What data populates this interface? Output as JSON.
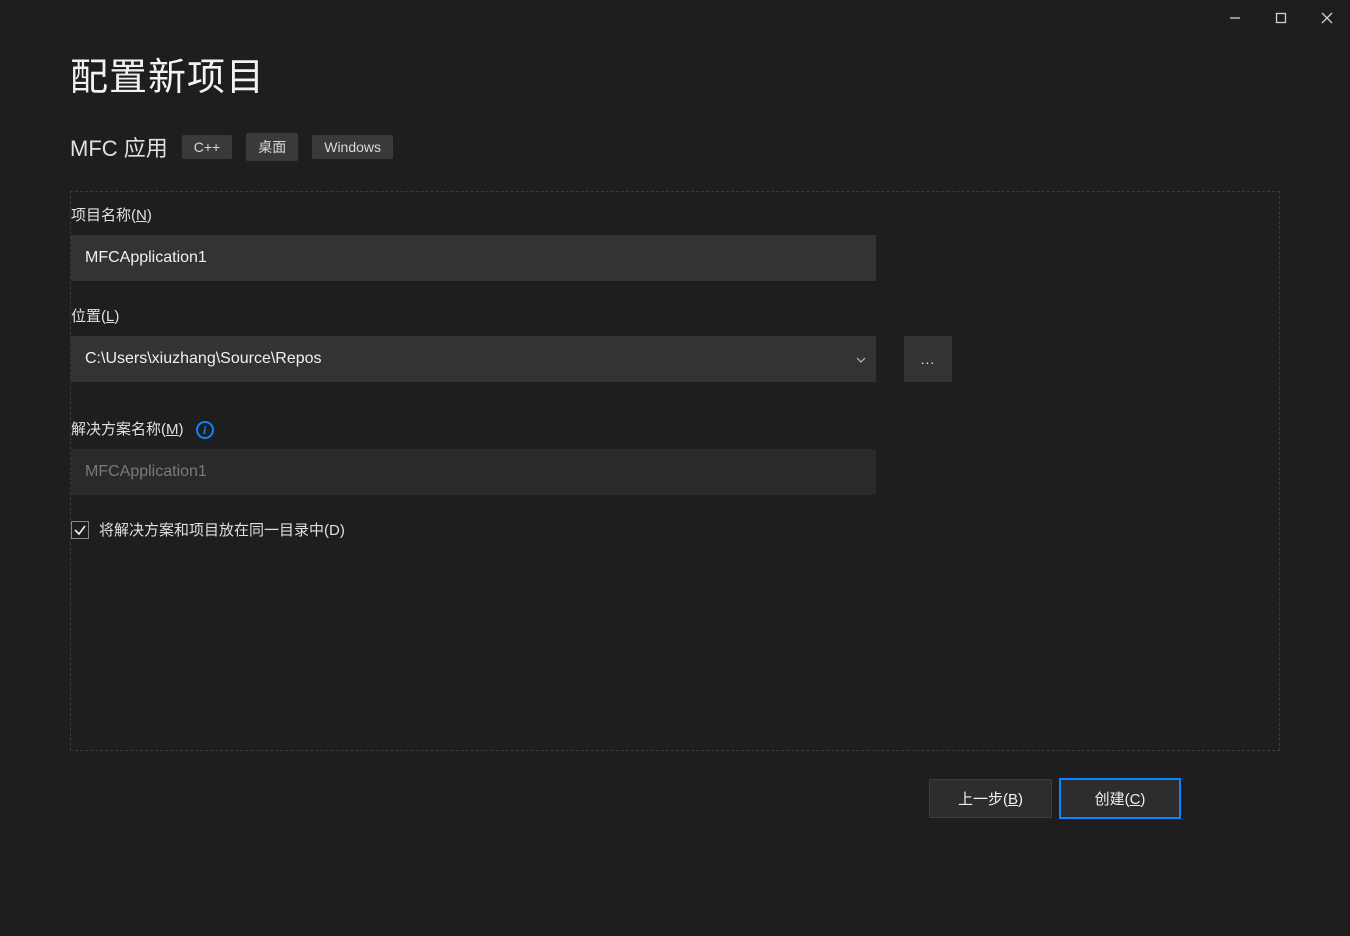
{
  "page_title": "配置新项目",
  "subtitle": "MFC 应用",
  "tags": [
    "C++",
    "桌面",
    "Windows"
  ],
  "fields": {
    "project_name": {
      "label_prefix": "项目名称(",
      "label_accel": "N",
      "label_suffix": ")",
      "value": "MFCApplication1"
    },
    "location": {
      "label_prefix": "位置(",
      "label_accel": "L",
      "label_suffix": ")",
      "value": "C:\\Users\\xiuzhang\\Source\\Repos",
      "browse_label": "..."
    },
    "solution_name": {
      "label_prefix": "解决方案名称(",
      "label_accel": "M",
      "label_suffix": ")",
      "value": "MFCApplication1"
    },
    "same_dir": {
      "label_prefix": "将解决方案和项目放在同一目录中(",
      "label_accel": "D",
      "label_suffix": ")",
      "checked": true
    }
  },
  "buttons": {
    "back_prefix": "上一步(",
    "back_accel": "B",
    "back_suffix": ")",
    "create_prefix": "创建(",
    "create_accel": "C",
    "create_suffix": ")"
  }
}
